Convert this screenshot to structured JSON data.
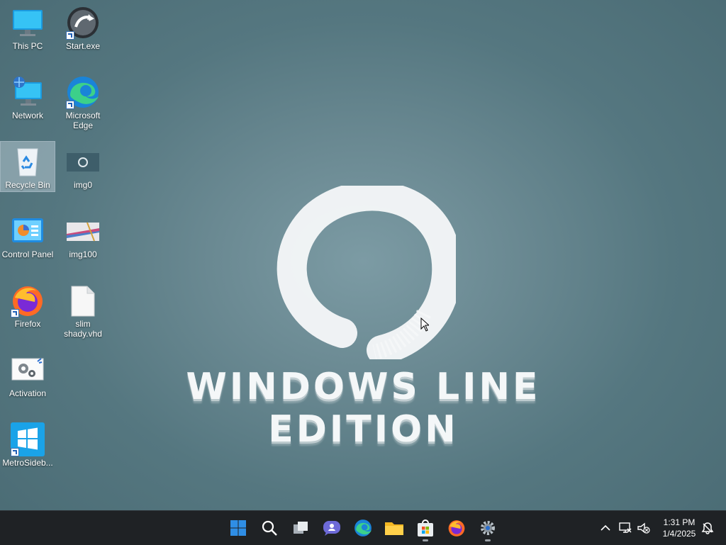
{
  "desktop": {
    "icons": [
      {
        "label": "This PC"
      },
      {
        "label": "Start.exe"
      },
      {
        "label": "Network"
      },
      {
        "label": "Microsoft Edge"
      },
      {
        "label": "Recycle Bin"
      },
      {
        "label": "img0"
      },
      {
        "label": "Control Panel"
      },
      {
        "label": "img100"
      },
      {
        "label": "Firefox"
      },
      {
        "label": "slim shady.vhd"
      },
      {
        "label": "Activation"
      },
      {
        "label": "MetroSideb..."
      }
    ],
    "wallpaper_text": "WINDOWS LINE EDITION"
  },
  "taskbar": {
    "items": [
      {
        "icon": "windows-start-icon"
      },
      {
        "icon": "search-icon"
      },
      {
        "icon": "task-view-icon"
      },
      {
        "icon": "chat-icon"
      },
      {
        "icon": "edge-icon"
      },
      {
        "icon": "file-explorer-icon"
      },
      {
        "icon": "store-icon"
      },
      {
        "icon": "firefox-icon"
      },
      {
        "icon": "settings-icon"
      }
    ],
    "clock": {
      "time": "1:31 PM",
      "date": "1/4/2025"
    }
  },
  "colors": {
    "taskbar": "#1f2225",
    "accent": "#0a78d4"
  }
}
